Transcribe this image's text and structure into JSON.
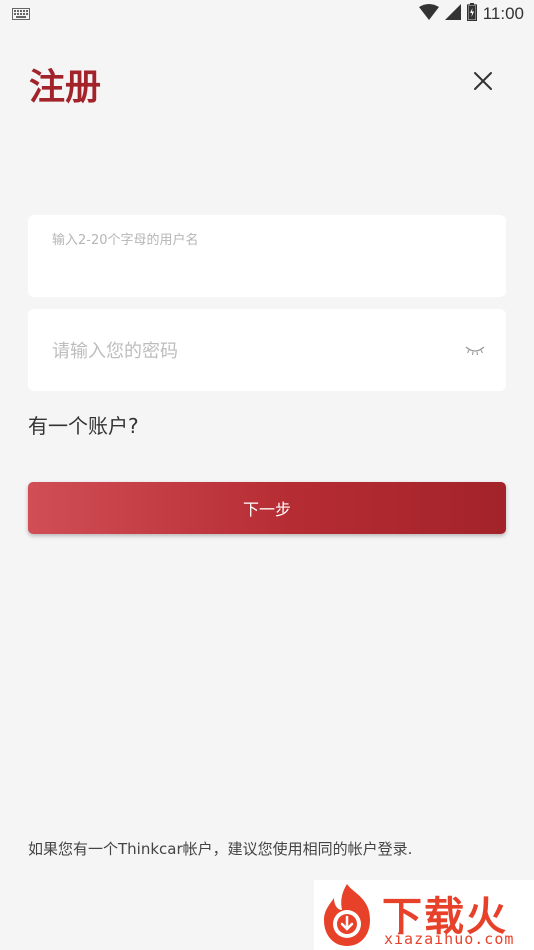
{
  "status_bar": {
    "time": "11:00",
    "icons": [
      "keyboard-icon",
      "wifi-icon",
      "cell-signal-icon",
      "battery-icon"
    ]
  },
  "header": {
    "title": "注册",
    "close_icon": "close-icon"
  },
  "form": {
    "username": {
      "placeholder": "输入2-20个字母的用户名",
      "value": ""
    },
    "password": {
      "placeholder": "请输入您的密码",
      "value": "",
      "toggle_icon": "eye-closed-icon"
    },
    "have_account_label": "有一个账户?",
    "next_label": "下一步"
  },
  "footer": {
    "note": "如果您有一个Thinkcar帐户，建议您使用相同的帐户登录."
  },
  "watermark": {
    "text": "下载火",
    "domain": "xiazaihuo.com"
  },
  "colors": {
    "accent": "#a3232b",
    "button_gradient_start": "#d14e56",
    "button_gradient_end": "#a3232b",
    "background": "#f5f5f5",
    "watermark": "#e8412a"
  }
}
